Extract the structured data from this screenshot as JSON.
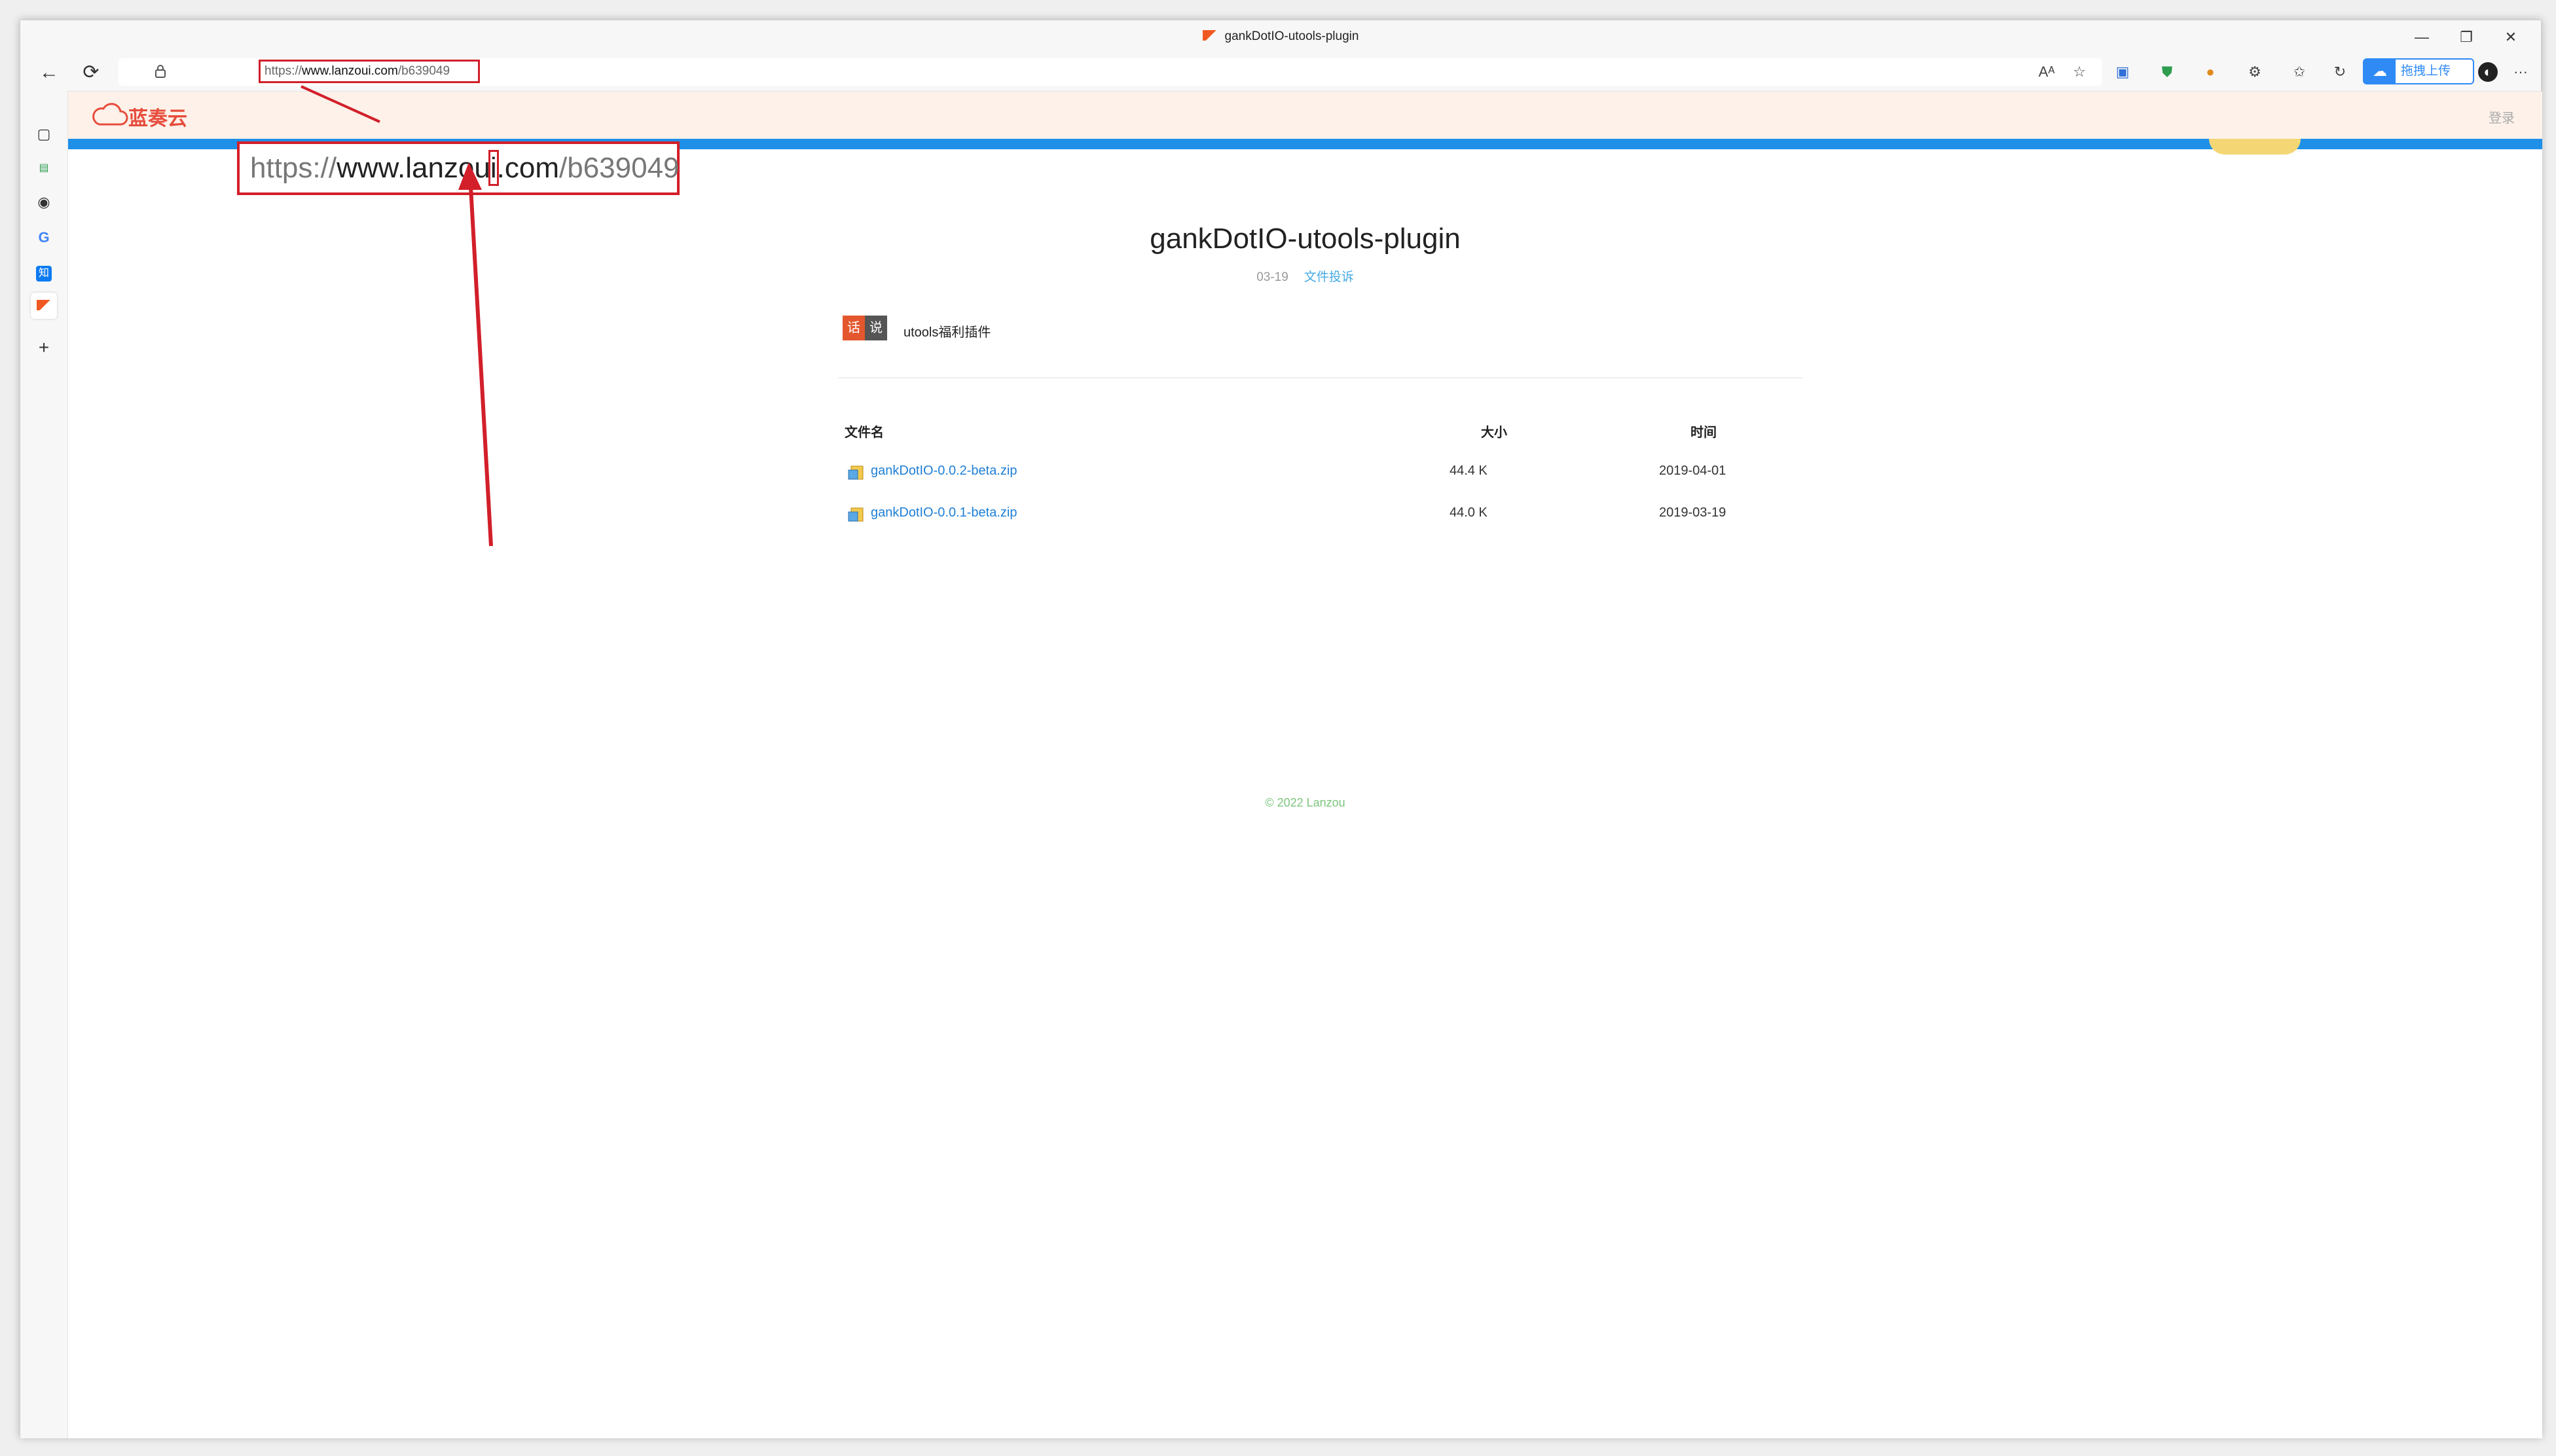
{
  "window": {
    "tab_title": "gankDotIO-utools-plugin",
    "controls": {
      "minimize": "—",
      "restore": "❐",
      "close": "✕"
    }
  },
  "toolbar": {
    "back": "←",
    "reload": "⟳",
    "url_scheme": "https://",
    "url_host": "www.lanzoui.com",
    "url_path": "/b639049",
    "icons": [
      "read-aloud-icon",
      "favorite-star-icon",
      "translate-icon",
      "shield-extension-icon",
      "cookie-icon",
      "extensions-icon",
      "favorites-icon",
      "collections-icon",
      "profile-avatar-icon",
      "more-icon"
    ],
    "upload_label": "拖拽上传",
    "more": "···"
  },
  "sidebar": {
    "icons": [
      "tabs-icon",
      "app-icon-1",
      "app-icon-2",
      "google-icon",
      "zhihu-icon",
      "lanzou-icon",
      "add-icon"
    ]
  },
  "site": {
    "logo_text": "蓝奏云",
    "login": "登录"
  },
  "zoom_annotation": {
    "scheme": "https://",
    "host_before": "www.lanzou",
    "host_highlight": "i",
    "host_after": ".com",
    "path": "/b639049"
  },
  "folder": {
    "title": "gankDotIO-utools-plugin",
    "date": "03-19",
    "report_link": "文件投诉",
    "tag_a": "话",
    "tag_b": "说",
    "description": "utools福利插件"
  },
  "table": {
    "headers": {
      "name": "文件名",
      "size": "大小",
      "time": "时间"
    },
    "rows": [
      {
        "name": "gankDotIO-0.0.2-beta.zip",
        "size": "44.4 K",
        "time": "2019-04-01"
      },
      {
        "name": "gankDotIO-0.0.1-beta.zip",
        "size": "44.0 K",
        "time": "2019-03-19"
      }
    ]
  },
  "footer": "© 2022 Lanzou",
  "colors": {
    "accent_blue": "#1e90e8",
    "annotation_red": "#d21f2a",
    "link_blue": "#1e7fd6",
    "header_bg": "#fdf1e9"
  }
}
